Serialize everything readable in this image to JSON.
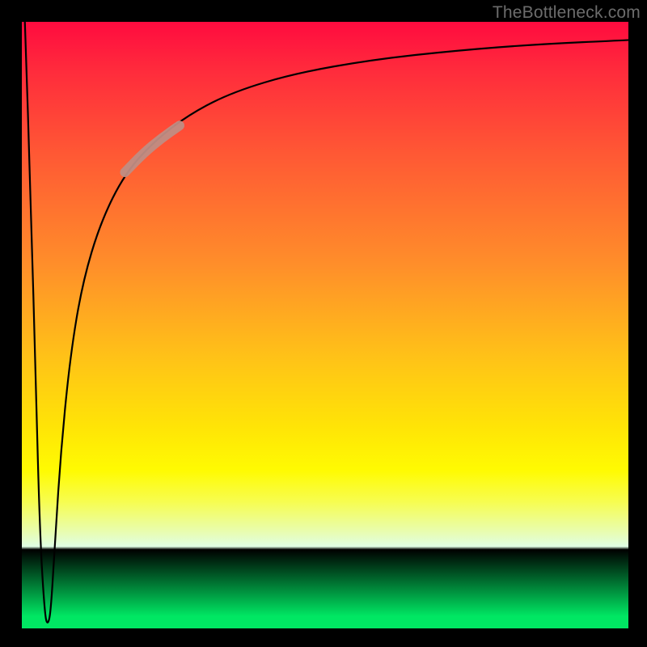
{
  "attribution": "TheBottleneck.com",
  "chart_data": {
    "type": "line",
    "title": "",
    "xlabel": "",
    "ylabel": "",
    "xlim": [
      0,
      100
    ],
    "ylim": [
      0,
      100
    ],
    "grid": false,
    "legend": false,
    "curve_points_xy": [
      [
        0.5,
        100
      ],
      [
        1.5,
        70
      ],
      [
        2.3,
        40
      ],
      [
        3.0,
        15
      ],
      [
        3.8,
        2
      ],
      [
        4.3,
        0.5
      ],
      [
        4.8,
        3
      ],
      [
        5.5,
        15
      ],
      [
        6.5,
        30
      ],
      [
        8,
        45
      ],
      [
        10,
        57
      ],
      [
        13,
        67
      ],
      [
        17,
        75
      ],
      [
        22,
        80.5
      ],
      [
        28,
        85
      ],
      [
        35,
        88.5
      ],
      [
        45,
        91.5
      ],
      [
        58,
        93.8
      ],
      [
        72,
        95.3
      ],
      [
        85,
        96.3
      ],
      [
        100,
        97
      ]
    ],
    "highlight_segment_xy": [
      [
        17,
        75.2
      ],
      [
        20,
        78.3
      ],
      [
        23,
        80.8
      ],
      [
        26,
        82.9
      ]
    ],
    "annotations": [],
    "colors": {
      "top": "#ff0b3f",
      "mid_high": "#ff8e2a",
      "mid": "#ffe506",
      "mid_low": "#f7fd4e",
      "bottom": "#00e763",
      "curve": "#000000",
      "highlight": "#c08d84"
    }
  }
}
